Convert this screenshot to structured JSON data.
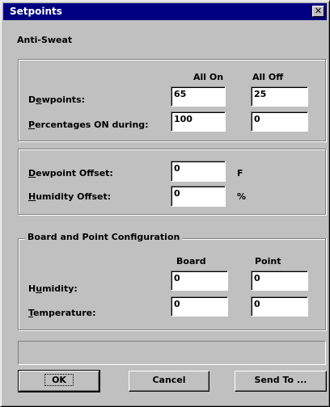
{
  "window": {
    "title": "Setpoints",
    "close_glyph": "✕"
  },
  "section_title": "Anti-Sweat",
  "antisweat": {
    "col_all_on": "All On",
    "col_all_off": "All Off",
    "dewpoints": {
      "label_hot": "e",
      "label_pre": "D",
      "label_post": "wpoints:",
      "all_on": "65",
      "all_off": "25"
    },
    "percentages": {
      "label_hot": "P",
      "label_post": "ercentages ON during:",
      "all_on": "100",
      "all_off": "0"
    }
  },
  "offsets": {
    "dewpoint": {
      "label_hot": "D",
      "label_post": "ewpoint Offset:",
      "value": "0",
      "unit": "F"
    },
    "humidity": {
      "label_hot": "H",
      "label_post": "umidity Offset:",
      "value": "0",
      "unit": "%"
    }
  },
  "board_config": {
    "title": "Board and Point Configuration",
    "col_board": "Board",
    "col_point": "Point",
    "humidity": {
      "label_pre": "H",
      "label_hot": "u",
      "label_post": "midity:",
      "board": "0",
      "point": "0"
    },
    "temperature": {
      "label_hot": "T",
      "label_post": "emperature:",
      "board": "0",
      "point": "0"
    }
  },
  "buttons": {
    "ok": "OK",
    "cancel": "Cancel",
    "send_to": "Send To ..."
  }
}
